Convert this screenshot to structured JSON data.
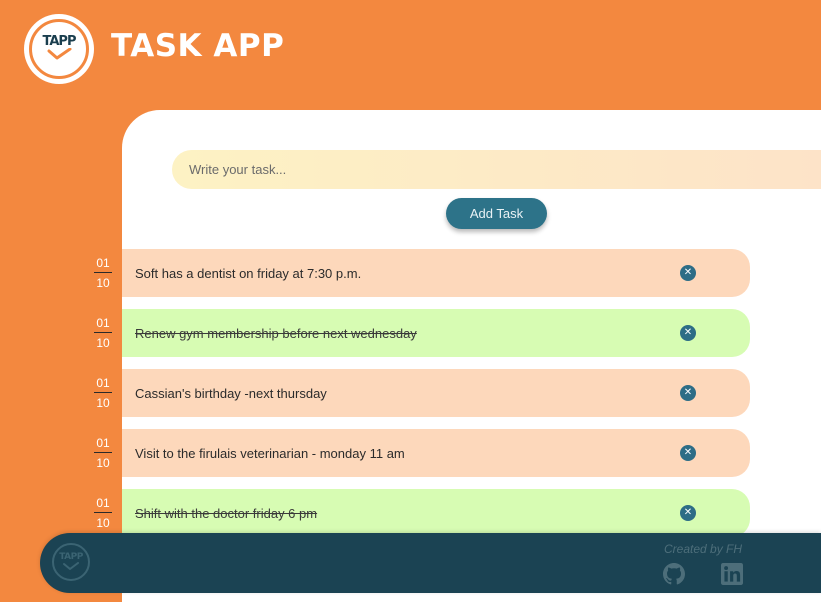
{
  "header": {
    "logo_text": "TAPP",
    "title": "TASK APP"
  },
  "form": {
    "placeholder": "Write your task...",
    "add_label": "Add Task"
  },
  "tasks": [
    {
      "day": "01",
      "month": "10",
      "text": "Soft has a dentist on friday at 7:30 p.m.",
      "done": false
    },
    {
      "day": "01",
      "month": "10",
      "text": "Renew gym membership before next wednesday",
      "done": true
    },
    {
      "day": "01",
      "month": "10",
      "text": "Cassian's birthday -next thursday",
      "done": false
    },
    {
      "day": "01",
      "month": "10",
      "text": "Visit to the firulais veterinarian - monday 11 am",
      "done": false
    },
    {
      "day": "01",
      "month": "10",
      "text": "Shift with the doctor friday 6 pm",
      "done": true
    }
  ],
  "footer": {
    "logo_text": "TAPP",
    "credit": "Created by FH",
    "icons": [
      "github-icon",
      "linkedin-icon"
    ]
  },
  "colors": {
    "background": "#f3883f",
    "pending_task": "#fdd8bb",
    "done_task": "#d7fcb3",
    "accent": "#2d7389",
    "footer": "#1b4353"
  }
}
